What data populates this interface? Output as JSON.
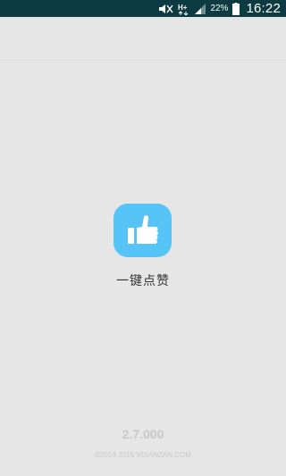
{
  "status_bar": {
    "battery_percent": "22%",
    "time": "16:22",
    "network_label": "H+",
    "icons": [
      "mute-icon",
      "network-h-plus-icon",
      "signal-icon",
      "battery-icon"
    ],
    "background_color": "#0c3b41"
  },
  "splash": {
    "app_name": "一键点赞",
    "app_icon": "thumbs-up-icon",
    "icon_color": "#56c4f6",
    "version": "2.7.000",
    "copyright": "©2014-2015 VDIANZAN.COM",
    "background_color": "#e6e6e6"
  }
}
